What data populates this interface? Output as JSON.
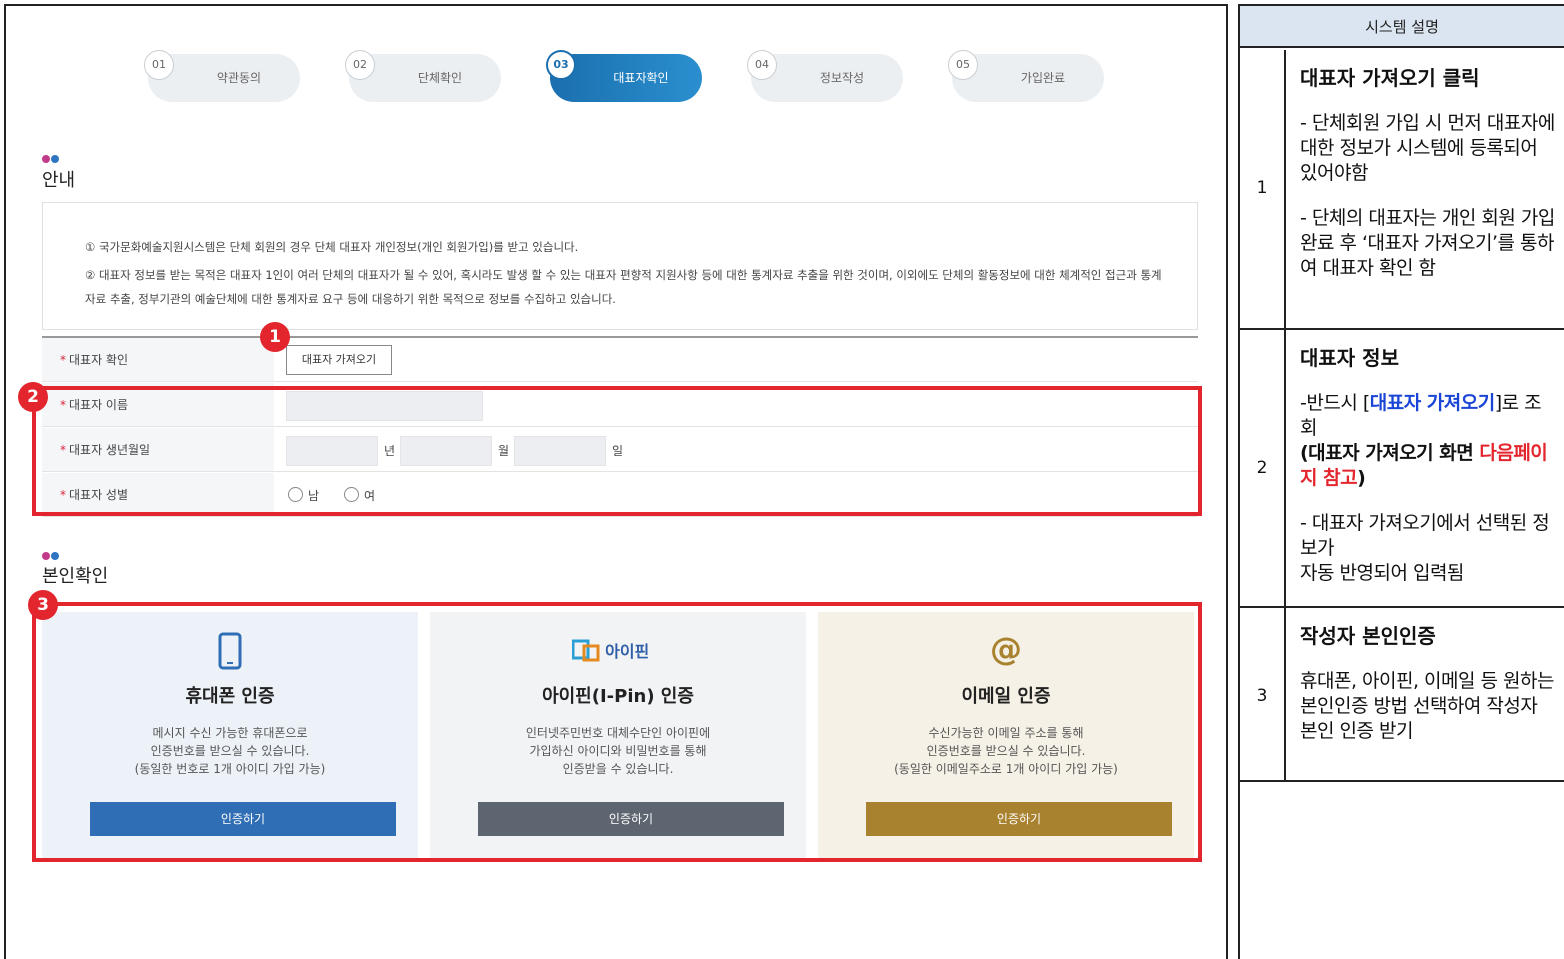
{
  "stepper": [
    {
      "num": "01",
      "label": "약관동의"
    },
    {
      "num": "02",
      "label": "단체확인"
    },
    {
      "num": "03",
      "label": "대표자확인",
      "active": true
    },
    {
      "num": "04",
      "label": "정보작성"
    },
    {
      "num": "05",
      "label": "가입완료"
    }
  ],
  "guide": {
    "title": "안내",
    "line1": "① 국가문화예술지원시스템은 단체 회원의 경우 단체 대표자 개인정보(개인 회원가입)를 받고 있습니다.",
    "line2": "② 대표자 정보를 받는 목적은 대표자 1인이 여러 단체의 대표자가 될 수 있어, 혹시라도 발생 할 수 있는 대표자 편향적 지원사항 등에 대한 통계자료 추출을 위한 것이며, 이외에도 단체의 활동정보에 대한 체계적인 접근과 통계자료 추출, 정부기관의 예술단체에 대한 통계자료 요구 등에 대응하기 위한 목적으로 정보를 수집하고 있습니다."
  },
  "form": {
    "required_mark": "*",
    "confirm_label": "대표자 확인",
    "fetch_button": "대표자 가져오기",
    "name_label": "대표자 이름",
    "birth_label": "대표자 생년월일",
    "year_unit": "년",
    "month_unit": "월",
    "day_unit": "일",
    "gender_label": "대표자 성별",
    "male": "남",
    "female": "여"
  },
  "identity": {
    "title": "본인확인",
    "methods": [
      {
        "title": "휴대폰 인증",
        "desc": "메시지 수신 가능한 휴대폰으로\n인증번호를 받으실 수 있습니다.\n(동일한 번호로 1개 아이디 가입 가능)",
        "button": "인증하기",
        "bg": "#edf2f8",
        "btn_color": "#2f6eb4",
        "icon": "mobile-phone-icon"
      },
      {
        "title": "아이핀(I-Pin) 인증",
        "desc": "인터넷주민번호 대체수단인 아이핀에\n가입하신 아이디와 비밀번호를 통해\n인증받을 수 있습니다.",
        "button": "인증하기",
        "bg": "#f2f3f5",
        "btn_color": "#5d6670",
        "icon": "ipin-logo",
        "logo_text": "아이핀"
      },
      {
        "title": "이메일 인증",
        "desc": "수신가능한 이메일 주소를 통해\n인증번호를 받으실 수 있습니다.\n(동일한 이메일주소로 1개 아이디 가입 가능)",
        "button": "인증하기",
        "bg": "#f6f1e6",
        "btn_color": "#a9822f",
        "icon": "at-sign-icon",
        "icon_text": "@"
      }
    ]
  },
  "markers": [
    "1",
    "2",
    "3"
  ],
  "side": {
    "header": "시스템 설명",
    "rows": [
      {
        "num": "1",
        "heading": "대표자 가져오기 클릭",
        "p1": "- 단체회원 가입 시 먼저 대표자에 대한 정보가 시스템에 등록되어 있어야함",
        "p2": "- 단체의 대표자는 개인 회원 가입 완료 후 ‘대표자 가져오기’를 통하여 대표자 확인 함"
      },
      {
        "num": "2",
        "heading": "대표자 정보",
        "p1_pre": "-반드시 [",
        "p1_link": "대표자 가져오기",
        "p1_post": "]로 조회",
        "p1_bold": "(대표자 가져오기 화면 ",
        "p1_red": "다음페이지 참고",
        "p1_close": ")",
        "p2": "- 대표자 가져오기에서 선택된 정보가\n  자동 반영되어 입력됨"
      },
      {
        "num": "3",
        "heading": "작성자 본인인증",
        "p1": "휴대폰, 아이핀, 이메일 등 원하는 본인인증 방법 선택하여 작성자 본인 인증 받기"
      }
    ]
  },
  "colors": {
    "accent": "#1b6fae",
    "marker": "#e3262e",
    "dot1": "#c13b8a",
    "dot2": "#2f74c0"
  }
}
